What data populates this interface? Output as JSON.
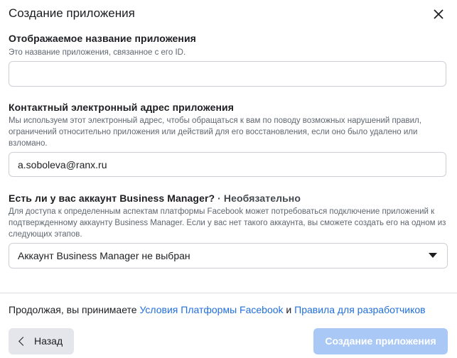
{
  "dialog": {
    "title": "Создание приложения"
  },
  "fields": {
    "app_name": {
      "label": "Отображаемое название приложения",
      "help": "Это название приложения, связанное с его ID.",
      "value": ""
    },
    "contact_email": {
      "label": "Контактный электронный адрес приложения",
      "help": "Мы используем этот электронный адрес, чтобы обращаться к вам по поводу возможных нарушений правил, ограничений относительно приложения или действий для его восстановления, если оно было удалено или взломано.",
      "value": "a.soboleva@ranx.ru"
    },
    "business_manager": {
      "label": "Есть ли у вас аккаунт Business Manager?",
      "optional": " · Необязательно",
      "help": "Для доступа к определенным аспектам платформы Facebook может потребоваться подключение приложений к подтвержденному аккаунту Business Manager. Если у вас нет такого аккаунта, вы сможете создать его на одном из следующих этапов.",
      "selected": "Аккаунт Business Manager не выбран"
    }
  },
  "footer": {
    "terms_prefix": "Продолжая, вы принимаете ",
    "terms_link_1": "Условия Платформы Facebook",
    "terms_and": " и ",
    "terms_link_2": "Правила для разработчиков",
    "back_label": "Назад",
    "create_label": "Создание приложения"
  },
  "colors": {
    "link": "#216fdb",
    "primary_disabled": "#a9c8f5",
    "secondary_button": "#e4e6eb"
  }
}
